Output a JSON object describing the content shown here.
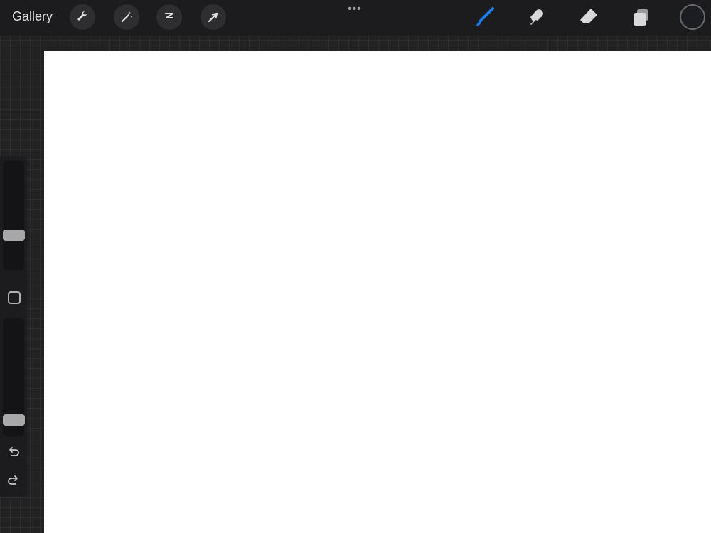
{
  "topbar": {
    "gallery_label": "Gallery",
    "more_label": "•••",
    "left_tools": [
      "wrench-icon",
      "magic-wand-icon",
      "selection-icon",
      "transform-arrow-icon"
    ],
    "right_tools": [
      "brush-icon",
      "smudge-icon",
      "eraser-icon",
      "layers-icon"
    ],
    "active_tool": "brush-icon",
    "accent_color": "#1a7cf5",
    "current_color": "#1b1d22"
  },
  "sidebar": {
    "brush_size_level": 0.3,
    "opacity_level": 0.1,
    "undo_icon": "undo-icon",
    "redo_icon": "redo-icon"
  }
}
